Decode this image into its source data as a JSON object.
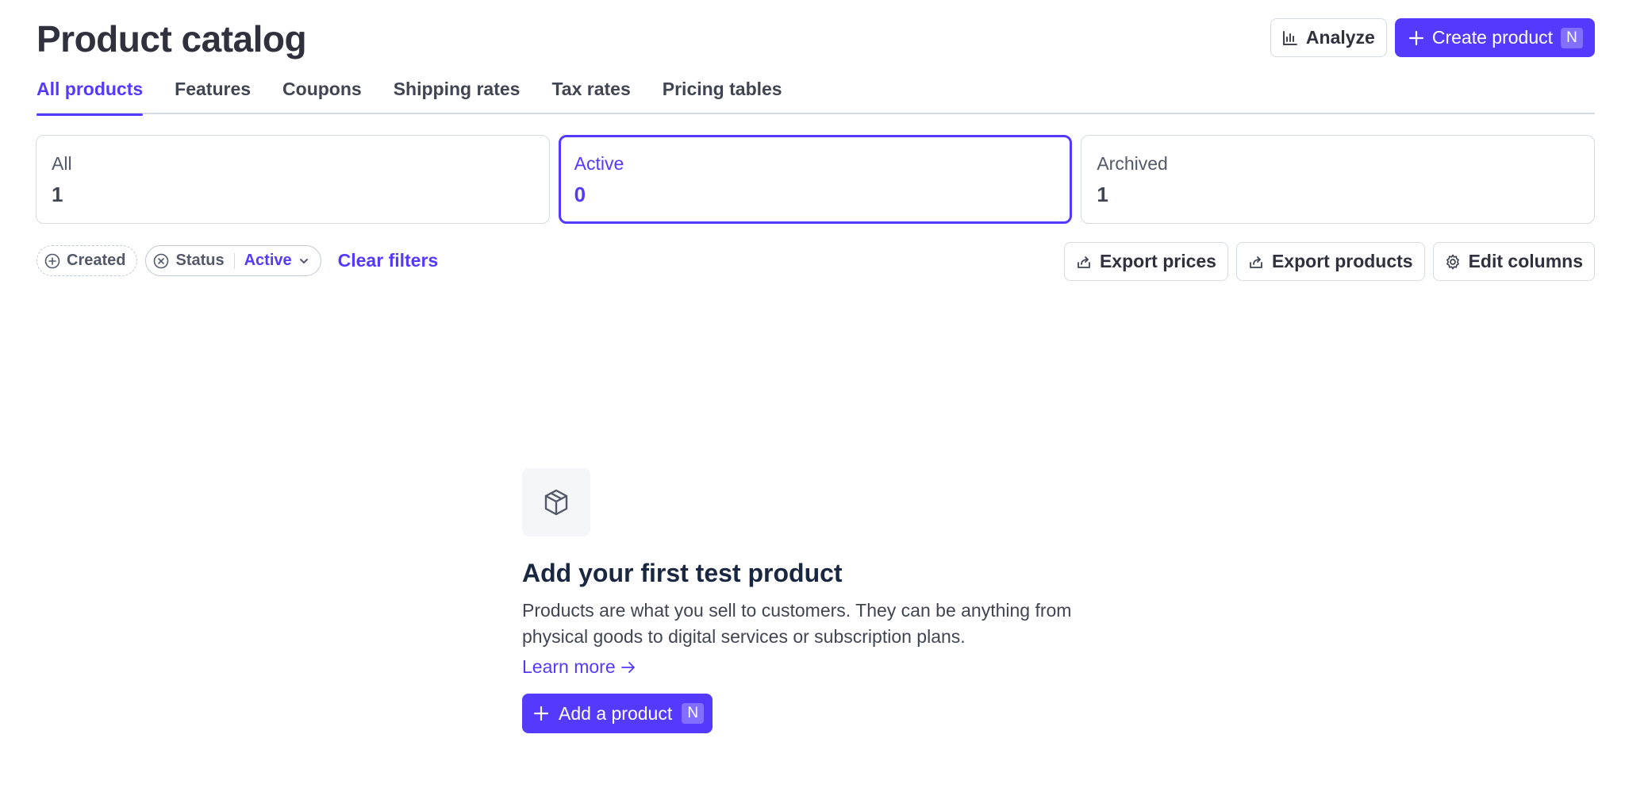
{
  "header": {
    "title": "Product catalog",
    "analyze_label": "Analyze",
    "create_label": "Create product",
    "create_shortcut": "N"
  },
  "tabs": [
    {
      "label": "All products",
      "active": true
    },
    {
      "label": "Features",
      "active": false
    },
    {
      "label": "Coupons",
      "active": false
    },
    {
      "label": "Shipping rates",
      "active": false
    },
    {
      "label": "Tax rates",
      "active": false
    },
    {
      "label": "Pricing tables",
      "active": false
    }
  ],
  "status_cards": [
    {
      "label": "All",
      "count": "1",
      "active": false
    },
    {
      "label": "Active",
      "count": "0",
      "active": true
    },
    {
      "label": "Archived",
      "count": "1",
      "active": false
    }
  ],
  "filters": {
    "created_label": "Created",
    "status_label": "Status",
    "status_value": "Active",
    "clear_label": "Clear filters",
    "export_prices_label": "Export prices",
    "export_products_label": "Export products",
    "edit_columns_label": "Edit columns"
  },
  "empty_state": {
    "title": "Add your first test product",
    "description": "Products are what you sell to customers. They can be anything from physical goods to digital services or subscription plans.",
    "learn_more": "Learn more",
    "add_label": "Add a product",
    "add_shortcut": "N"
  },
  "colors": {
    "accent": "#533afd",
    "text": "#30313d",
    "border": "#d5dbe1"
  }
}
